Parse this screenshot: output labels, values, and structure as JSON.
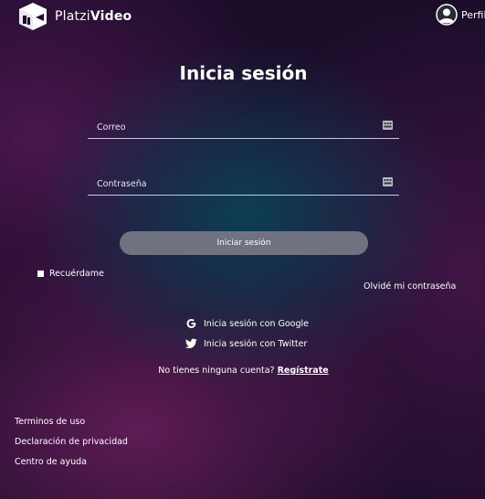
{
  "header": {
    "logo_text_light": "Platzi",
    "logo_text_bold": "Video",
    "logo_icon": "platzi-cube-icon",
    "profile_label": "Perfil",
    "profile_icon": "user-avatar-icon"
  },
  "login": {
    "title": "Inicia sesión",
    "email_placeholder": "Correo",
    "email_value": "",
    "password_placeholder": "Contraseña",
    "password_value": "",
    "field_icon": "autofill-key-icon",
    "submit_label": "Iniciar sesión",
    "remember_label": "Recuérdame",
    "forgot_label": "Olvidé mi contraseña"
  },
  "social": {
    "google_label": "Inicia sesión con Google",
    "twitter_label": "Inicia sesión con Twitter"
  },
  "register": {
    "prompt": "No tienes ninguna cuenta?",
    "link": "Regístrate"
  },
  "footer": {
    "links": [
      "Terminos de uso",
      "Declaración de privacidad",
      "Centro de ayuda"
    ]
  },
  "colors": {
    "background": "#1b0d2a",
    "glow_teal": "#0d3f55",
    "glow_magenta": "#96287a",
    "button": "#71727f",
    "text": "#ffffff"
  }
}
